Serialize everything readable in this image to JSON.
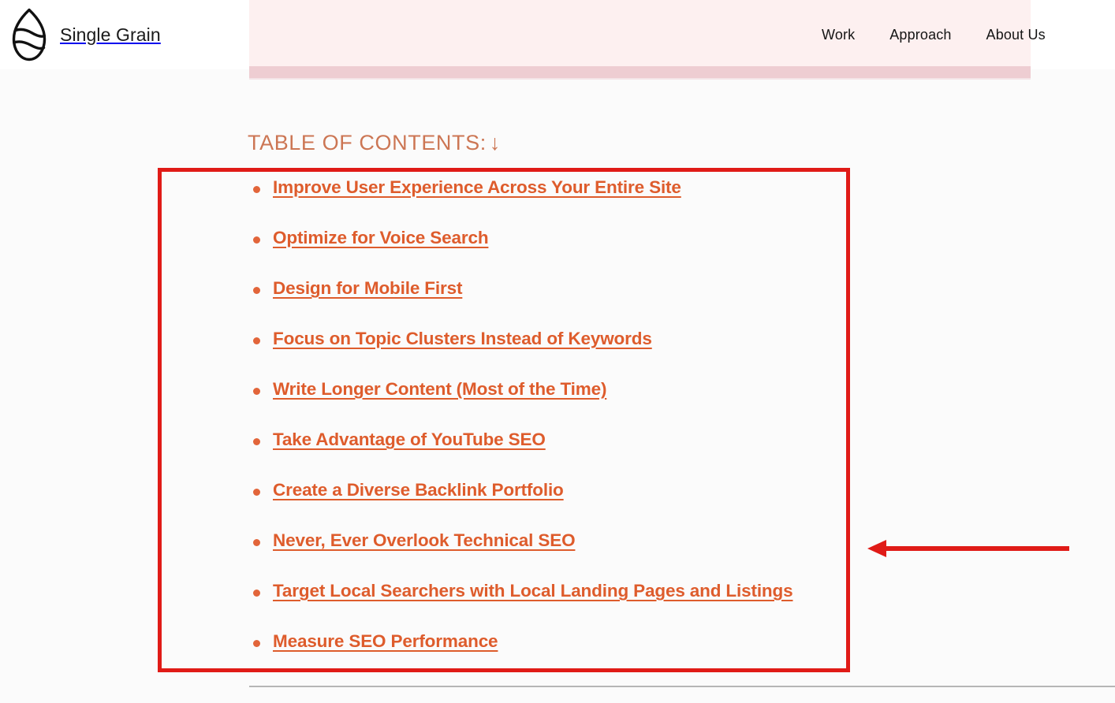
{
  "site": {
    "brand_name": "Single Grain",
    "logo_icon": "single-grain-logo-icon"
  },
  "header": {
    "nav_items": [
      {
        "label": "Work"
      },
      {
        "label": "Approach"
      },
      {
        "label": "About Us"
      }
    ]
  },
  "article": {
    "toc_heading": "TABLE OF CONTENTS:",
    "toc_heading_arrow": "↓",
    "toc_items": [
      {
        "label": "Improve User Experience Across Your Entire Site"
      },
      {
        "label": "Optimize for Voice Search"
      },
      {
        "label": "Design for Mobile First"
      },
      {
        "label": "Focus on Topic Clusters Instead of Keywords"
      },
      {
        "label": "Write Longer Content (Most of the Time)"
      },
      {
        "label": "Take Advantage of YouTube SEO"
      },
      {
        "label": "Create a Diverse Backlink Portfolio"
      },
      {
        "label": "Never, Ever Overlook Technical SEO"
      },
      {
        "label": "Target Local Searchers with Local Landing Pages and Listings"
      },
      {
        "label": "Measure SEO Performance"
      }
    ]
  },
  "annotations": {
    "highlight_box_color": "#e01b17",
    "arrow_color": "#e01b17",
    "arrow_direction": "left",
    "arrow_icon": "left-arrow-annotation-icon"
  },
  "colors": {
    "link_orange": "#de5c2c",
    "heading_orange": "#cc7654",
    "bullet_orange": "#e2653a",
    "banner_pink": "#fdf0f0",
    "banner_bar_pink": "#eecdd2",
    "page_background": "#fcfcfc",
    "nav_text": "#151515",
    "divider_gray": "#b6b6b6"
  }
}
